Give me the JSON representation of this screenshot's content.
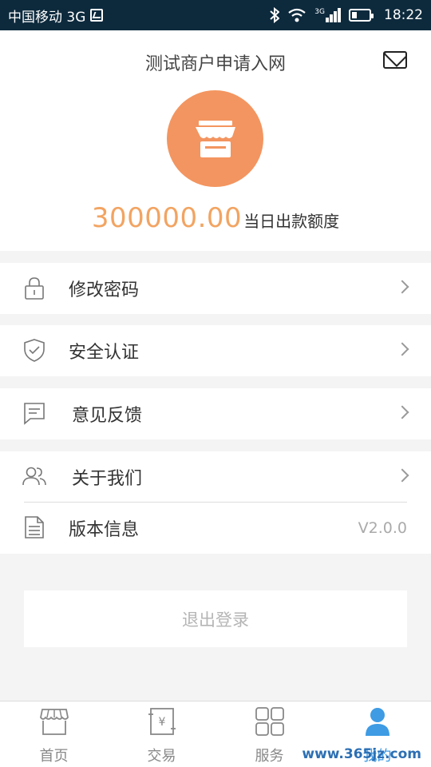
{
  "status_bar": {
    "carrier": "中国移动 3G",
    "network": "3G",
    "time": "18:22"
  },
  "header": {
    "title": "测试商户申请入网",
    "mail_icon": "mail-icon",
    "store_icon": "store-icon",
    "limit_amount": "300000.00",
    "limit_label": "当日出款额度",
    "accent_color": "#f39560",
    "amount_color": "#f2a462"
  },
  "menu": [
    {
      "label": "修改密码",
      "icon": "lock-icon"
    },
    {
      "label": "安全认证",
      "icon": "shield-icon"
    },
    {
      "label": "意见反馈",
      "icon": "feedback-icon"
    },
    {
      "label": "关于我们",
      "icon": "users-icon"
    },
    {
      "label": "版本信息",
      "icon": "document-icon",
      "value": "V2.0.0"
    }
  ],
  "logout": {
    "label": "退出登录"
  },
  "tabs": [
    {
      "label": "首页",
      "icon": "home-store-icon"
    },
    {
      "label": "交易",
      "icon": "transaction-icon"
    },
    {
      "label": "服务",
      "icon": "grid-icon"
    },
    {
      "label": "我的",
      "icon": "user-icon",
      "active": true
    }
  ],
  "watermark": "www.365jz.com",
  "active_tab_color": "#3e9be4"
}
